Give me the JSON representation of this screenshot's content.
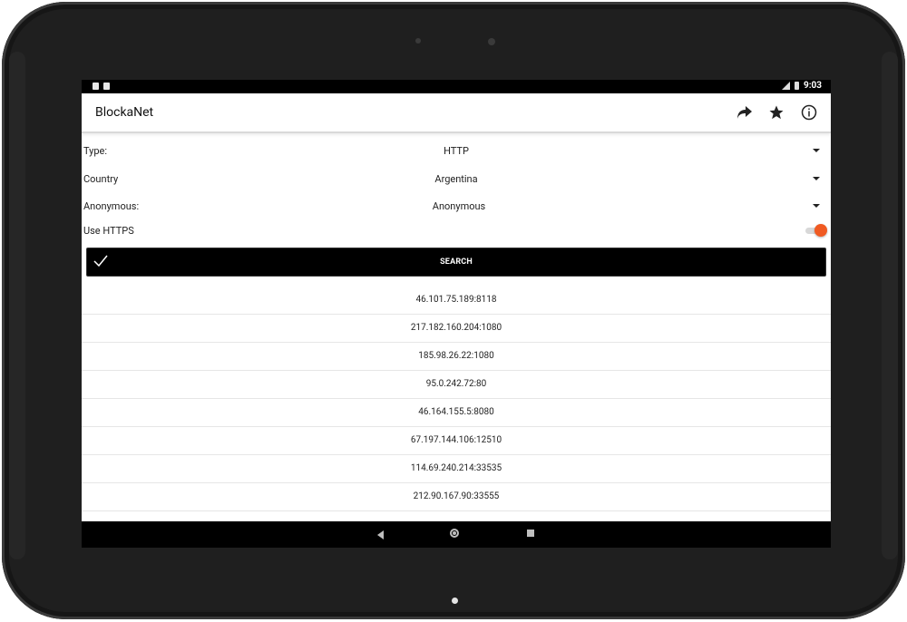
{
  "status_bar": {
    "time": "9:03"
  },
  "app_bar": {
    "title": "BlockaNet",
    "actions": [
      "share-icon",
      "star-icon",
      "info-icon"
    ]
  },
  "filters": {
    "type": {
      "label": "Type:",
      "value": "HTTP"
    },
    "country": {
      "label": "Country",
      "value": "Argentina"
    },
    "anonymous": {
      "label": "Anonymous:",
      "value": "Anonymous"
    },
    "use_https": {
      "label": "Use HTTPS",
      "enabled": true
    }
  },
  "search_button": {
    "label": "SEARCH",
    "icon": "check-icon"
  },
  "proxies": [
    "46.101.75.189:8118",
    "217.182.160.204:1080",
    "185.98.26.22:1080",
    "95.0.242.72:80",
    "46.164.155.5:8080",
    "67.197.144.106:12510",
    "114.69.240.214:33535",
    "212.90.167.90:33555"
  ],
  "colors": {
    "accent": "#f05a22",
    "button_bg": "#000000"
  }
}
